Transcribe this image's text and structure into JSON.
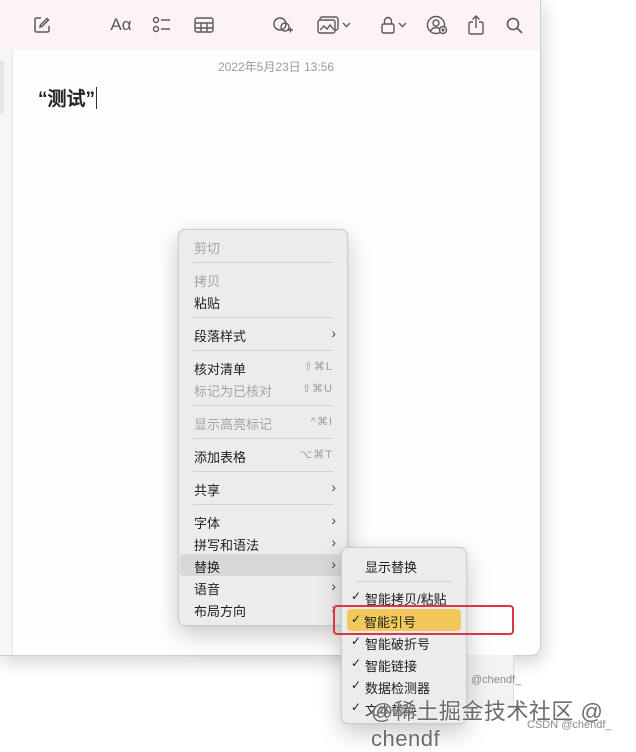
{
  "toolbar": {
    "icons": [
      "compose-icon",
      "text-format-icon",
      "checklist-icon",
      "table-icon",
      "collaborate-icon",
      "media-icon",
      "lock-icon",
      "share-user-icon",
      "share-icon",
      "search-icon"
    ],
    "format_label": "Aα"
  },
  "note": {
    "date": "2022年5月23日 13:56",
    "title": "“测试”"
  },
  "context_menu": {
    "items": {
      "cut": "剪切",
      "copy": "拷贝",
      "paste": "粘贴",
      "paragraph_style": "段落样式",
      "check_list": "核对清单",
      "check_list_shortcut": "⇧⌘L",
      "mark_checked": "标记为已核对",
      "mark_checked_shortcut": "⇧⌘U",
      "show_highlights": "显示高亮标记",
      "show_highlights_shortcut": "^⌘I",
      "add_table": "添加表格",
      "add_table_shortcut": "⌥⌘T",
      "share": "共享",
      "font": "字体",
      "spelling": "拼写和语法",
      "substitutions": "替换",
      "speech": "语音",
      "layout": "布局方向"
    },
    "arrow": "›"
  },
  "substitutions_menu": {
    "show": "显示替换",
    "check": "✓",
    "smart_copy_paste": "智能拷贝/粘贴",
    "smart_quotes": "智能引号",
    "smart_dashes": "智能破折号",
    "smart_links": "智能链接",
    "data_detectors": "数据检测器",
    "text_replacement": "文本替换"
  },
  "watermark": {
    "small": "@chendf_",
    "big": "@稀土掘金技术社区 @ chendf",
    "csdn": "CSDN @chendf_"
  },
  "colors": {
    "toolbar_bg": "#fdf2f5",
    "highlight": "#f0c95a",
    "annotation": "#d9363e"
  }
}
